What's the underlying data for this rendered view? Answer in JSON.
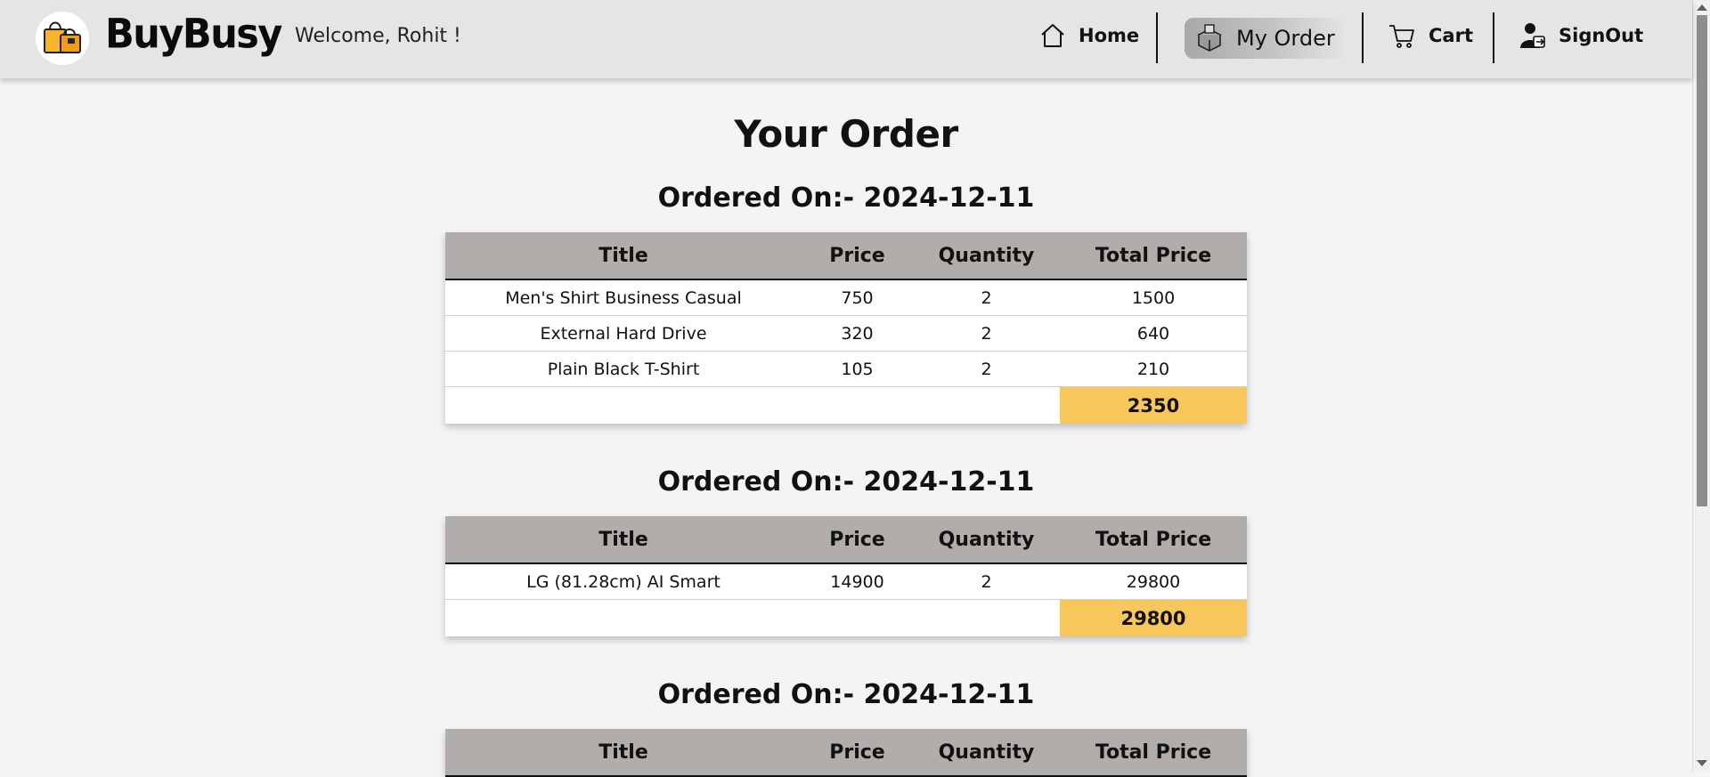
{
  "header": {
    "brand": "BuyBusy",
    "welcome": "Welcome, Rohit !",
    "nav": {
      "home": "Home",
      "my_order": "My Order",
      "cart": "Cart",
      "signout": "SignOut"
    },
    "icons": {
      "logo": "shopping-bags-icon",
      "home": "home-icon",
      "my_order": "order-box-icon",
      "cart": "cart-icon",
      "signout": "user-signout-icon"
    }
  },
  "main": {
    "title": "Your Order",
    "columns": [
      "Title",
      "Price",
      "Quantity",
      "Total Price"
    ],
    "orders": [
      {
        "heading": "Ordered On:- 2024-12-11",
        "items": [
          {
            "title": "Men's Shirt Business Casual",
            "price": "750",
            "quantity": "2",
            "total": "1500"
          },
          {
            "title": "External Hard Drive",
            "price": "320",
            "quantity": "2",
            "total": "640"
          },
          {
            "title": "Plain Black T-Shirt",
            "price": "105",
            "quantity": "2",
            "total": "210"
          }
        ],
        "grand_total": "2350"
      },
      {
        "heading": "Ordered On:- 2024-12-11",
        "items": [
          {
            "title": "LG (81.28cm) AI Smart",
            "price": "14900",
            "quantity": "2",
            "total": "29800"
          }
        ],
        "grand_total": "29800"
      },
      {
        "heading": "Ordered On:- 2024-12-11",
        "items": [],
        "grand_total": ""
      }
    ]
  },
  "colors": {
    "navbar_bg": "#e5e5e7",
    "page_bg": "#f3f4f6",
    "table_header_bg": "#b1adab",
    "total_highlight": "#f8c75c"
  }
}
